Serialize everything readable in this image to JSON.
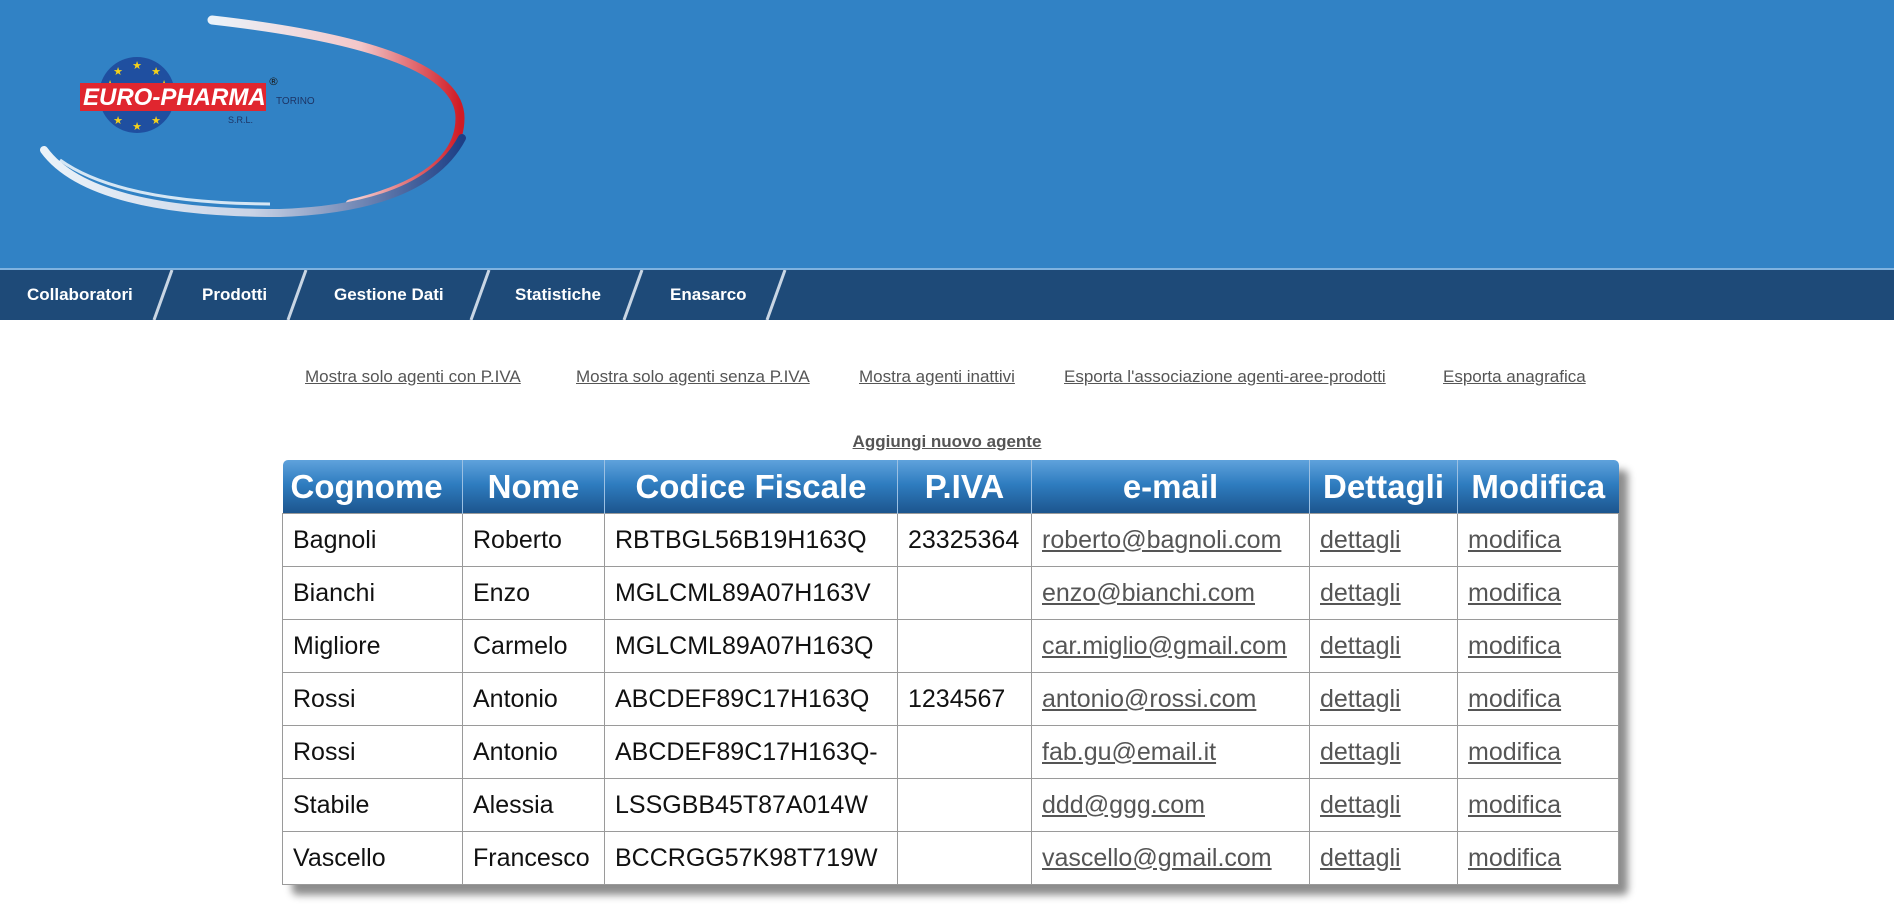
{
  "logo": {
    "brand": "EURO-PHARMA",
    "city": "TORINO",
    "company_type": "S.R.L.",
    "registered": "®"
  },
  "nav": {
    "items": [
      {
        "label": "Collaboratori"
      },
      {
        "label": "Prodotti"
      },
      {
        "label": "Gestione Dati"
      },
      {
        "label": "Statistiche"
      },
      {
        "label": "Enasarco"
      }
    ]
  },
  "filters": [
    {
      "label": "Mostra solo agenti con P.IVA"
    },
    {
      "label": "Mostra solo agenti senza P.IVA"
    },
    {
      "label": "Mostra agenti inattivi"
    },
    {
      "label": "Esporta l'associazione agenti-aree-prodotti"
    },
    {
      "label": "Esporta anagrafica"
    }
  ],
  "add_agent_label": "Aggiungi nuovo agente",
  "table": {
    "headers": [
      "Cognome",
      "Nome",
      "Codice Fiscale",
      "P.IVA",
      "e-mail",
      "Dettagli",
      "Modifica"
    ],
    "rows": [
      {
        "cognome": "Bagnoli",
        "nome": "Roberto",
        "cf": "RBTBGL56B19H163Q",
        "piva": "23325364",
        "email": "roberto@bagnoli.com",
        "details": "dettagli",
        "edit": "modifica"
      },
      {
        "cognome": "Bianchi",
        "nome": "Enzo",
        "cf": "MGLCML89A07H163V",
        "piva": "",
        "email": "enzo@bianchi.com",
        "details": "dettagli",
        "edit": "modifica"
      },
      {
        "cognome": "Migliore",
        "nome": "Carmelo",
        "cf": "MGLCML89A07H163Q",
        "piva": "",
        "email": "car.miglio@gmail.com",
        "details": "dettagli",
        "edit": "modifica"
      },
      {
        "cognome": "Rossi",
        "nome": "Antonio",
        "cf": "ABCDEF89C17H163Q",
        "piva": "1234567",
        "email": "antonio@rossi.com",
        "details": "dettagli",
        "edit": "modifica"
      },
      {
        "cognome": "Rossi",
        "nome": "Antonio",
        "cf": "ABCDEF89C17H163Q-",
        "piva": "",
        "email": "fab.gu@email.it",
        "details": "dettagli",
        "edit": "modifica"
      },
      {
        "cognome": "Stabile",
        "nome": "Alessia",
        "cf": "LSSGBB45T87A014W",
        "piva": "",
        "email": "ddd@ggg.com",
        "details": "dettagli",
        "edit": "modifica"
      },
      {
        "cognome": "Vascello",
        "nome": "Francesco",
        "cf": "BCCRGG57K98T719W",
        "piva": "",
        "email": "vascello@gmail.com",
        "details": "dettagli",
        "edit": "modifica"
      }
    ]
  },
  "colors": {
    "header_bg": "#3182c5",
    "nav_bg": "#1e4a78",
    "table_header_top": "#5fa2dc",
    "table_header_bottom": "#1c558e",
    "link": "#555555",
    "logo_red": "#e0262f"
  }
}
